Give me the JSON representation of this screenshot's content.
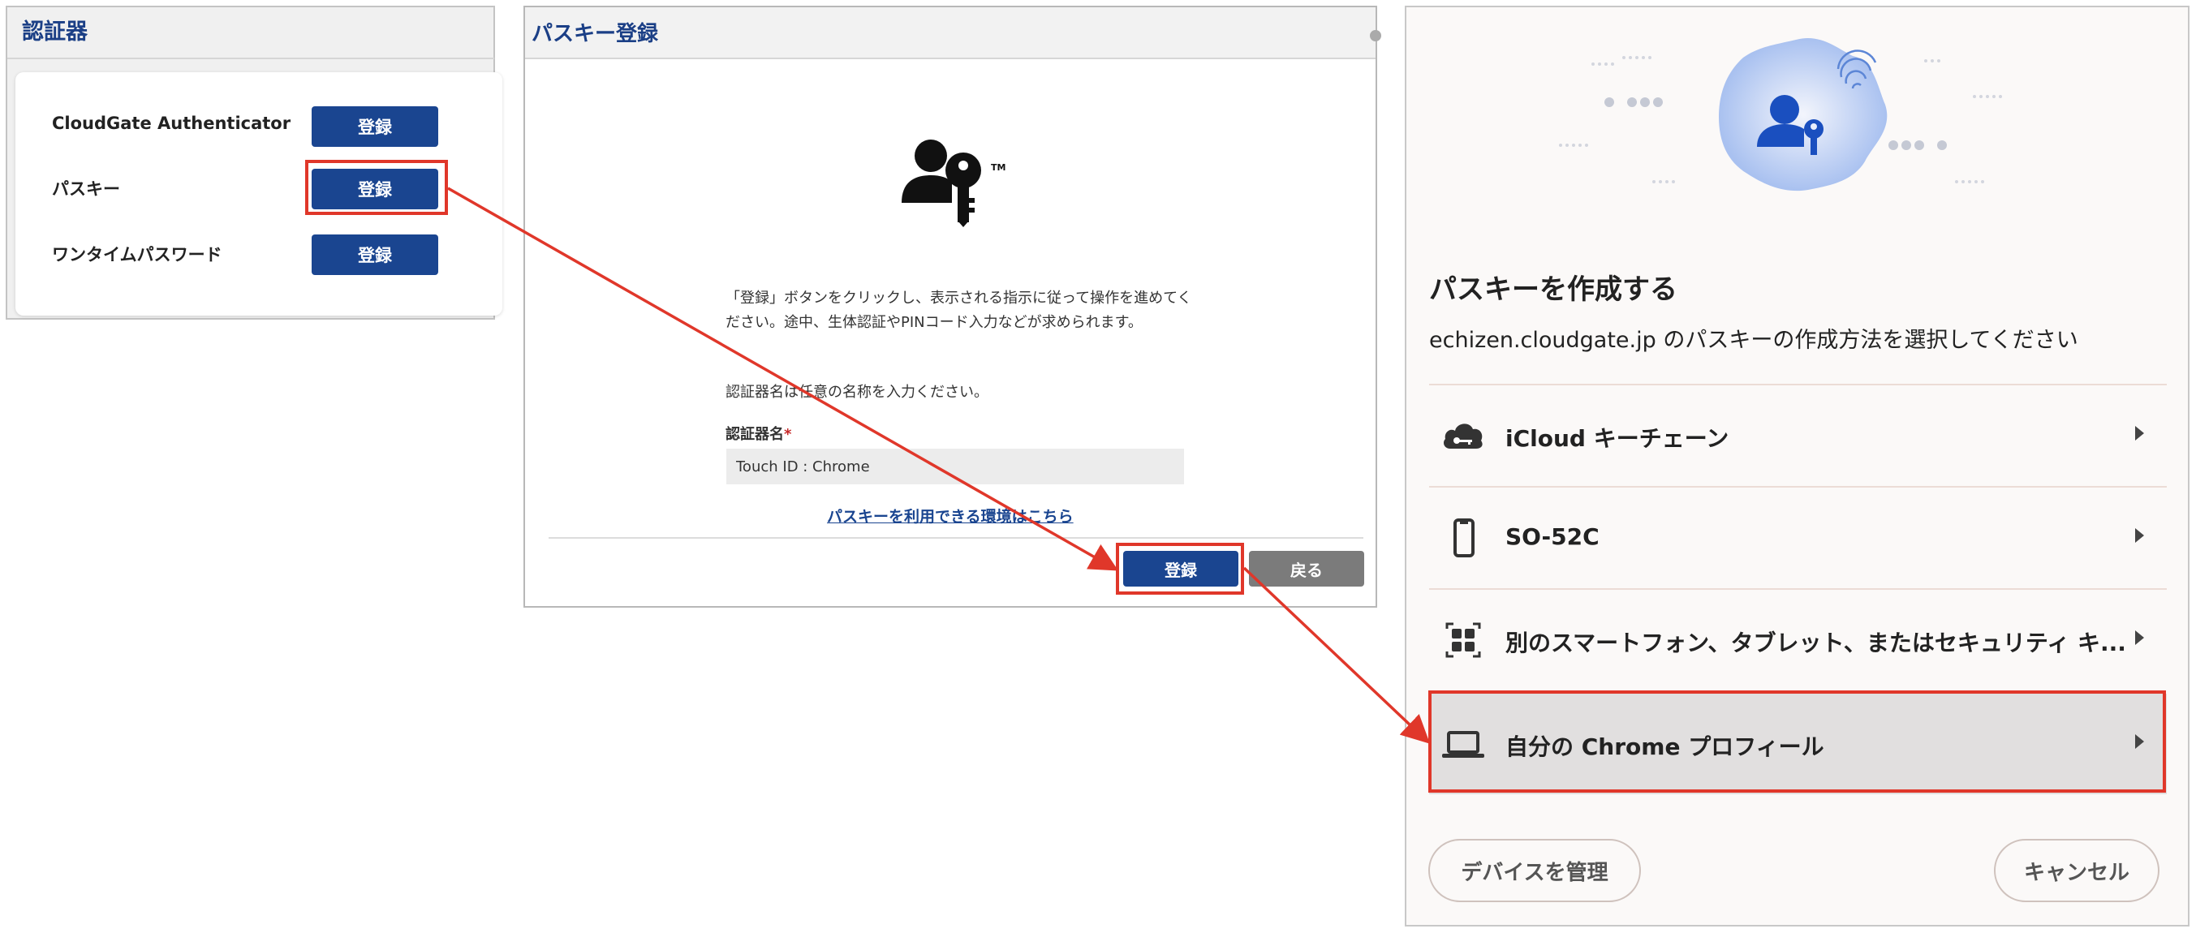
{
  "authenticators_panel": {
    "title": "認証器",
    "rows": [
      {
        "label": "CloudGate Authenticator",
        "button": "登録"
      },
      {
        "label": "パスキー",
        "button": "登録"
      },
      {
        "label": "ワンタイムパスワード",
        "button": "登録"
      }
    ]
  },
  "passkey_register_panel": {
    "title": "パスキー登録",
    "description": "「登録」ボタンをクリックし、表示される指示に従って操作を進めてください。途中、生体認証やPINコード入力などが求められます。",
    "name_hint": "認証器名は任意の名称を入力ください。",
    "field_label": "認証器名",
    "required_mark": "*",
    "field_value": "Touch ID : Chrome",
    "env_link": "パスキーを利用できる環境はこちら",
    "register_button": "登録",
    "back_button": "戻る",
    "tm_mark": "TM"
  },
  "create_passkey_dialog": {
    "title": "パスキーを作成する",
    "subtitle": "echizen.cloudgate.jp のパスキーの作成方法を選択してください",
    "options": [
      {
        "label": "iCloud キーチェーン",
        "icon": "cloud-key-icon"
      },
      {
        "label": "SO-52C",
        "icon": "smartphone-icon"
      },
      {
        "label": "別のスマートフォン、タブレット、またはセキュリティ キ...",
        "icon": "qr-code-icon"
      },
      {
        "label": "自分の Chrome プロフィール",
        "icon": "laptop-icon"
      }
    ],
    "manage_devices_button": "デバイスを管理",
    "cancel_button": "キャンセル"
  },
  "colors": {
    "primary_blue": "#1a4590",
    "highlight_red": "#e0372a",
    "selected_option_bg": "#e1dfdf"
  }
}
